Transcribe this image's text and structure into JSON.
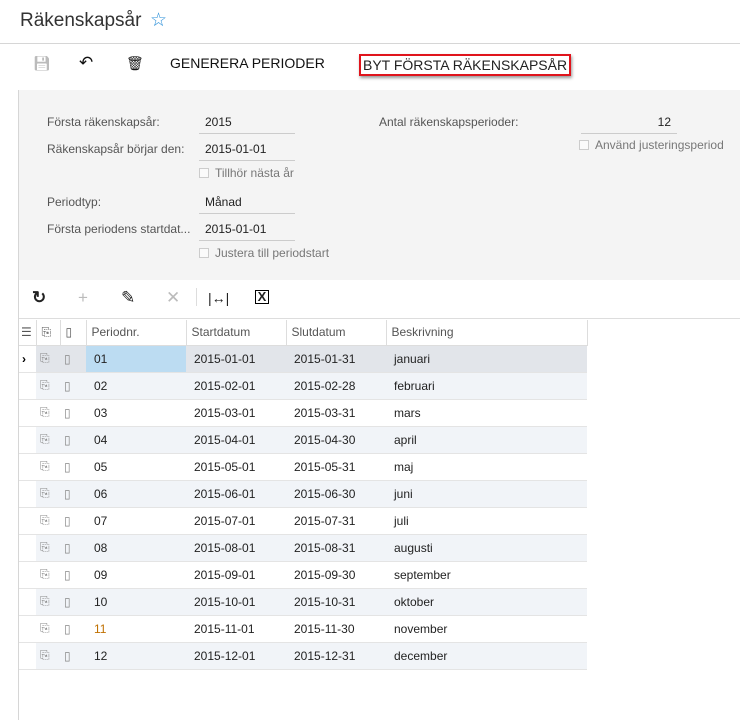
{
  "header": {
    "title": "Räkenskapsår"
  },
  "toolbar": {
    "generate": "GENERERA PERIODER",
    "change_first": "BYT FÖRSTA RÄKENSKAPSÅR"
  },
  "form": {
    "first_year_label": "Första räkenskapsår:",
    "first_year": "2015",
    "year_start_label": "Räkenskapsår börjar den:",
    "year_start": "2015-01-01",
    "belongs_next": "Tillhör nästa år",
    "period_type_label": "Periodtyp:",
    "period_type": "Månad",
    "first_period_start_label": "Första periodens startdat...",
    "first_period_start": "2015-01-01",
    "adjust_to_start": "Justera till periodstart",
    "num_periods_label": "Antal räkenskapsperioder:",
    "num_periods": "12",
    "use_adjustment": "Använd justeringsperiod"
  },
  "grid": {
    "columns": [
      "Periodnr.",
      "Startdatum",
      "Slutdatum",
      "Beskrivning"
    ],
    "rows": [
      [
        "01",
        "2015-01-01",
        "2015-01-31",
        "januari"
      ],
      [
        "02",
        "2015-02-01",
        "2015-02-28",
        "februari"
      ],
      [
        "03",
        "2015-03-01",
        "2015-03-31",
        "mars"
      ],
      [
        "04",
        "2015-04-01",
        "2015-04-30",
        "april"
      ],
      [
        "05",
        "2015-05-01",
        "2015-05-31",
        "maj"
      ],
      [
        "06",
        "2015-06-01",
        "2015-06-30",
        "juni"
      ],
      [
        "07",
        "2015-07-01",
        "2015-07-31",
        "juli"
      ],
      [
        "08",
        "2015-08-01",
        "2015-08-31",
        "augusti"
      ],
      [
        "09",
        "2015-09-01",
        "2015-09-30",
        "september"
      ],
      [
        "10",
        "2015-10-01",
        "2015-10-31",
        "oktober"
      ],
      [
        "11",
        "2015-11-01",
        "2015-11-30",
        "november"
      ],
      [
        "12",
        "2015-12-01",
        "2015-12-31",
        "december"
      ]
    ]
  }
}
